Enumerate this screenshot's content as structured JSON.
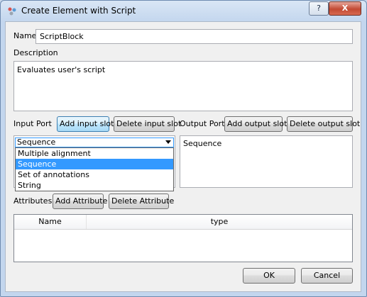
{
  "window": {
    "title": "Create Element with Script",
    "help_label": "?",
    "close_label": "X"
  },
  "name": {
    "label": "Name",
    "value": "ScriptBlock"
  },
  "description": {
    "label": "Description",
    "value": "Evaluates user's script"
  },
  "input_port": {
    "label": "Input Port",
    "add_button": "Add input slot",
    "delete_button": "Delete input slot",
    "selected": "Sequence",
    "options": [
      "Multiple alignment",
      "Sequence",
      "Set of annotations",
      "String"
    ]
  },
  "output_port": {
    "label": "Output Port",
    "add_button": "Add output slot",
    "delete_button": "Delete output slot",
    "value": "Sequence"
  },
  "attributes": {
    "label": "Attributes",
    "add_button": "Add Attribute",
    "delete_button": "Delete Attribute",
    "columns": [
      "Name",
      "type"
    ]
  },
  "footer": {
    "ok_label": "OK",
    "cancel_label": "Cancel"
  },
  "icons": {
    "app": "script-gear-icon",
    "help": "help-icon",
    "close": "close-icon",
    "dropdown": "chevron-down-icon"
  }
}
